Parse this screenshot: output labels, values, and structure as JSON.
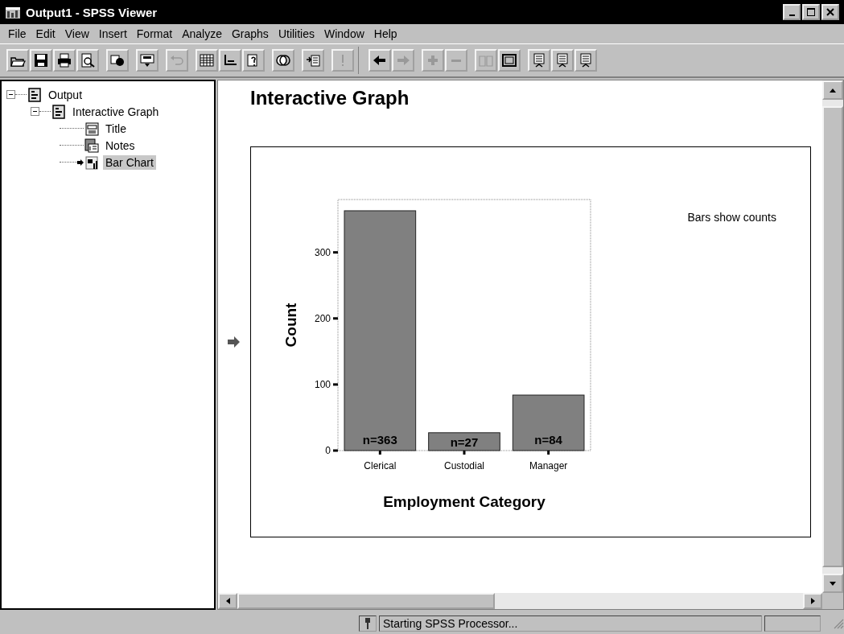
{
  "window": {
    "title": "Output1 - SPSS Viewer"
  },
  "menu": [
    {
      "label": "File"
    },
    {
      "label": "Edit"
    },
    {
      "label": "View"
    },
    {
      "label": "Insert"
    },
    {
      "label": "Format"
    },
    {
      "label": "Analyze"
    },
    {
      "label": "Graphs"
    },
    {
      "label": "Utilities"
    },
    {
      "label": "Window"
    },
    {
      "label": "Help"
    }
  ],
  "toolbar": [
    [
      {
        "kind": "open",
        "disabled": false
      },
      {
        "kind": "save",
        "disabled": false
      },
      {
        "kind": "print",
        "disabled": false
      },
      {
        "kind": "preview",
        "disabled": false
      }
    ],
    [
      {
        "kind": "export",
        "disabled": false
      }
    ],
    [
      {
        "kind": "recall",
        "disabled": false
      }
    ],
    [
      {
        "kind": "undo",
        "disabled": true
      }
    ],
    [
      {
        "kind": "grid",
        "disabled": false
      },
      {
        "kind": "goto",
        "disabled": false
      },
      {
        "kind": "info",
        "disabled": false
      }
    ],
    [
      {
        "kind": "sets",
        "disabled": false
      }
    ],
    [
      {
        "kind": "designate",
        "disabled": false
      }
    ],
    [
      {
        "kind": "run",
        "disabled": true
      }
    ],
    [
      {
        "kind": "back",
        "disabled": false
      },
      {
        "kind": "forward",
        "disabled": true
      }
    ],
    [
      {
        "kind": "promote",
        "disabled": true
      },
      {
        "kind": "demote",
        "disabled": true
      }
    ],
    [
      {
        "kind": "show",
        "disabled": true
      },
      {
        "kind": "hide",
        "disabled": false
      }
    ],
    [
      {
        "kind": "heading",
        "disabled": false
      },
      {
        "kind": "title",
        "disabled": false
      },
      {
        "kind": "text",
        "disabled": false
      }
    ]
  ],
  "outline": [
    {
      "label": "Output",
      "kind": "folder",
      "expanded": true,
      "selected": false,
      "children": [
        {
          "label": "Interactive Graph",
          "kind": "folder",
          "expanded": true,
          "selected": false,
          "children": [
            {
              "label": "Title",
              "kind": "title",
              "selected": false
            },
            {
              "label": "Notes",
              "kind": "notes",
              "selected": false
            },
            {
              "label": "Bar Chart",
              "kind": "chart",
              "selected": true
            }
          ]
        }
      ]
    }
  ],
  "content": {
    "heading": "Interactive Graph",
    "chart_data": {
      "type": "bar",
      "xlabel": "Employment Category",
      "ylabel": "Count",
      "categories": [
        "Clerical",
        "Custodial",
        "Manager"
      ],
      "series": [
        {
          "color": "#808080",
          "values": [
            363,
            27,
            84
          ]
        }
      ],
      "ylim": [
        0,
        380
      ],
      "yticks": [
        0,
        100,
        200,
        300
      ],
      "value_labels": [
        "n=363",
        "n=27",
        "n=84"
      ],
      "annotations": [
        "Bars show counts"
      ]
    }
  },
  "status_bar": {
    "message": "Starting SPSS Processor..."
  }
}
